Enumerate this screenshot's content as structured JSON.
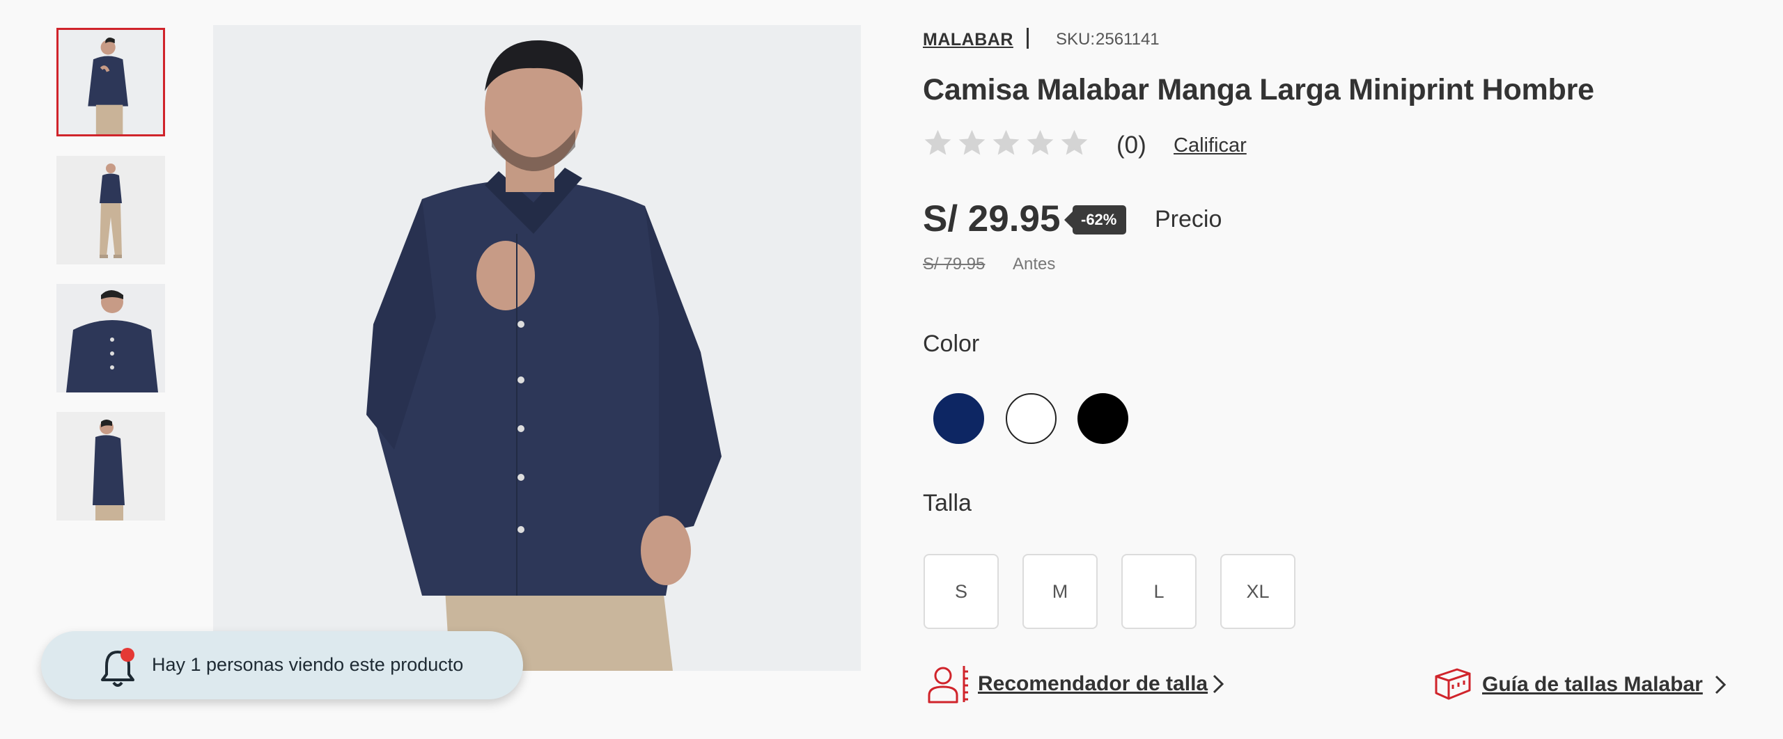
{
  "thumbnails": [
    {
      "name": "Vista frontal",
      "active": true
    },
    {
      "name": "Vista cuerpo completo",
      "active": false
    },
    {
      "name": "Vista primer plano",
      "active": false
    },
    {
      "name": "Vista lateral",
      "active": false
    }
  ],
  "notification": {
    "icon": "bell-icon",
    "text": "Hay 1 personas viendo este producto"
  },
  "product": {
    "brand": "MALABAR",
    "sku_label": "SKU:",
    "sku_value": "2561141",
    "title": "Camisa Malabar Manga Larga Miniprint Hombre",
    "rating": {
      "stars_filled": 0,
      "stars_total": 5,
      "count": "(0)",
      "rate_link": "Calificar"
    },
    "price": {
      "current": "S/ 29.95",
      "discount": "-62%",
      "current_label": "Precio",
      "old": "S/ 79.95",
      "old_label": "Antes"
    },
    "color": {
      "label": "Color",
      "options": [
        {
          "name": "Azul",
          "hex": "#0d2663",
          "selected": true
        },
        {
          "name": "Blanco",
          "hex": "#ffffff",
          "selected": false
        },
        {
          "name": "Negro",
          "hex": "#000000",
          "selected": false
        }
      ]
    },
    "size": {
      "label": "Talla",
      "options": [
        "S",
        "M",
        "L",
        "XL"
      ]
    },
    "size_recommender": "Recomendador de talla",
    "size_guide": "Guía de tallas Malabar"
  },
  "colors": {
    "accent": "#d0242b",
    "text": "#333333",
    "badge": "#3a3a3a",
    "notification_bg": "#dde9ee"
  }
}
